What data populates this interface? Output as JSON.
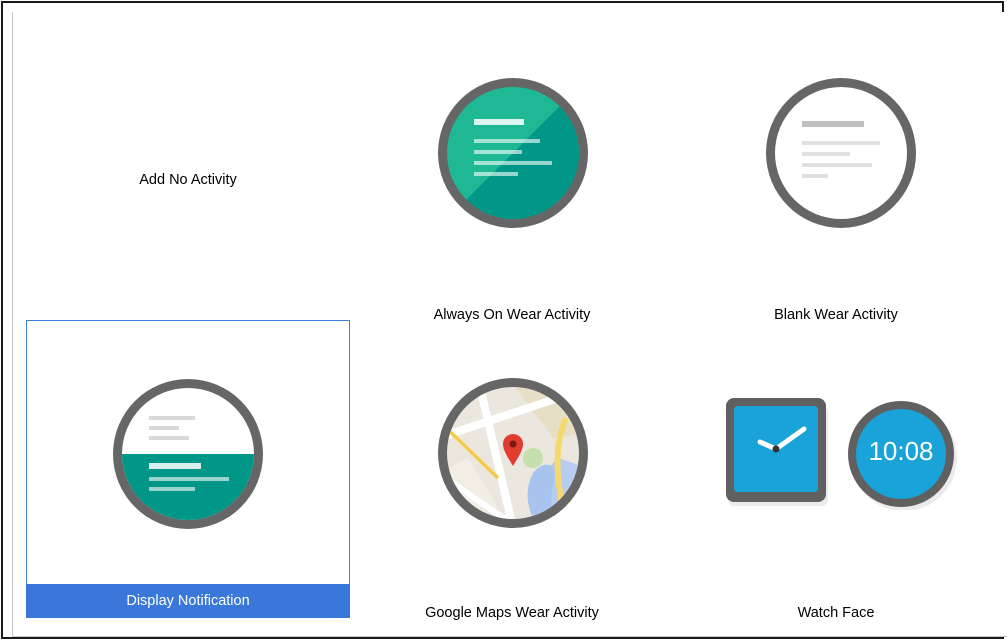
{
  "templates": [
    {
      "id": "no-activity",
      "label": "Add No Activity"
    },
    {
      "id": "always-on",
      "label": "Always On Wear Activity"
    },
    {
      "id": "blank-wear",
      "label": "Blank Wear Activity"
    },
    {
      "id": "display-notification",
      "label": "Display Notification",
      "selected": true
    },
    {
      "id": "google-maps",
      "label": "Google Maps Wear Activity"
    },
    {
      "id": "watch-face",
      "label": "Watch Face",
      "clock_time": "10:08"
    }
  ],
  "colors": {
    "selection": "#3978d8",
    "teal": "#1fb894",
    "teal_dark": "#009688",
    "bezel": "#666666",
    "watch_blue": "#1aa3d8"
  }
}
